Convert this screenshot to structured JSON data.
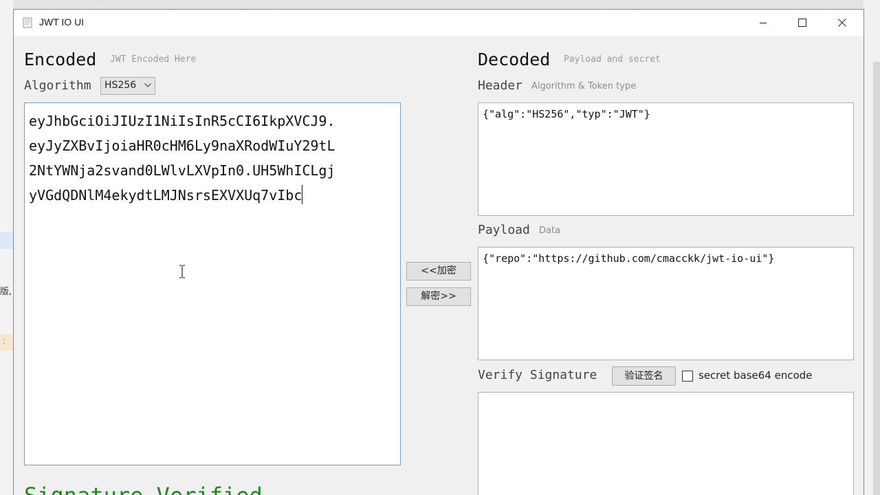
{
  "window": {
    "title": "JWT IO UI"
  },
  "encoded": {
    "title": "Encoded",
    "hint": "JWT Encoded Here",
    "algorithm_label": "Algorithm",
    "algorithm_value": "HS256",
    "token_lines": [
      "eyJhbGciOiJIUzI1NiIsInR5cCI6IkpXVCJ9.",
      "eyJyZXBvIjoiaHR0cHM6Ly9naXRodWIuY29tL",
      "2NtYWNja2svand0LWlvLXVpIn0.UH5WhICLgj",
      "yVGdQDNlM4ekydtLMJNsrsEXVXUq7vIbc"
    ],
    "status": "Signature Verified"
  },
  "actions": {
    "encrypt_label": "<<加密",
    "decrypt_label": "解密>>"
  },
  "decoded": {
    "title": "Decoded",
    "hint": "Payload and secret",
    "header_label": "Header",
    "header_sub": "Algorithm & Token type",
    "header_value": "{\"alg\":\"HS256\",\"typ\":\"JWT\"}",
    "payload_label": "Payload",
    "payload_sub": "Data",
    "payload_value": "{\"repo\":\"https://github.com/cmacckk/jwt-io-ui\"}",
    "verify_label": "Verify Signature",
    "verify_button": "验证签名",
    "checkbox_label": "secret base64 encode",
    "checkbox_checked": false,
    "secret_value": ""
  },
  "background": {
    "fragment_text": "版,"
  },
  "colors": {
    "verified": "#1e8a1e",
    "input_border": "#7a9cc6"
  }
}
